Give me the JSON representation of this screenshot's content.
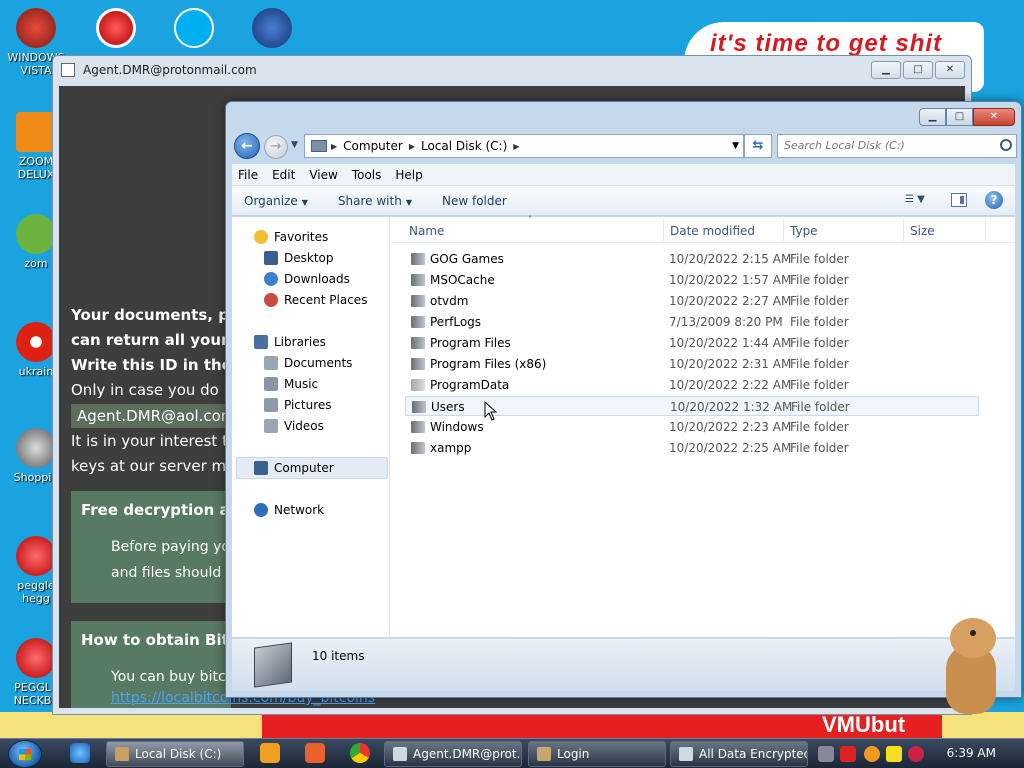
{
  "desktop": {
    "banner_text": "it's time to get shit",
    "bottom_text": "VMUbut",
    "icons": [
      {
        "label": "WINDOWS VISTA"
      },
      {
        "label": "ZOOM DELUX"
      },
      {
        "label": "zom"
      },
      {
        "label": "ukrain"
      },
      {
        "label": "Shoppin"
      },
      {
        "label": "peggle hegg"
      },
      {
        "label": "PEGGLE NECKBE"
      }
    ]
  },
  "ransom_window": {
    "title": "Agent.DMR@protonmail.com",
    "line1": "Your documents, pho",
    "line2": "can return all your fi",
    "line3": "Write this ID in the s",
    "line4": "Only in case you do not",
    "email": "Agent.DMR@aol.com",
    "line5": "It is in your interest to r",
    "line6": "keys at our server more",
    "box1_heading": "Free decryption as",
    "box1_line1": "Before paying you",
    "box1_line2": "and files should no",
    "box2_heading": "How to obtain Bitco",
    "box2_line1": "You can buy bitco",
    "link": "https://localbitcoins.com/buy_bitcoins"
  },
  "explorer": {
    "address": {
      "seg1": "Computer",
      "seg2": "Local Disk (C:)"
    },
    "search_placeholder": "Search Local Disk (C:)",
    "menu": [
      "File",
      "Edit",
      "View",
      "Tools",
      "Help"
    ],
    "toolbar": {
      "organize": "Organize",
      "share_with": "Share with",
      "new_folder": "New folder"
    },
    "nav": {
      "favorites": "Favorites",
      "desktop": "Desktop",
      "downloads": "Downloads",
      "recent_places": "Recent Places",
      "libraries": "Libraries",
      "documents": "Documents",
      "music": "Music",
      "pictures": "Pictures",
      "videos": "Videos",
      "computer": "Computer",
      "network": "Network"
    },
    "columns": {
      "name": "Name",
      "date": "Date modified",
      "type": "Type",
      "size": "Size"
    },
    "files": [
      {
        "name": "GOG Games",
        "date": "10/20/2022 2:15 AM",
        "type": "File folder"
      },
      {
        "name": "MSOCache",
        "date": "10/20/2022 1:57 AM",
        "type": "File folder"
      },
      {
        "name": "otvdm",
        "date": "10/20/2022 2:27 AM",
        "type": "File folder"
      },
      {
        "name": "PerfLogs",
        "date": "7/13/2009 8:20 PM",
        "type": "File folder"
      },
      {
        "name": "Program Files",
        "date": "10/20/2022 1:44 AM",
        "type": "File folder"
      },
      {
        "name": "Program Files (x86)",
        "date": "10/20/2022 2:31 AM",
        "type": "File folder"
      },
      {
        "name": "ProgramData",
        "date": "10/20/2022 2:22 AM",
        "type": "File folder"
      },
      {
        "name": "Users",
        "date": "10/20/2022 1:32 AM",
        "type": "File folder"
      },
      {
        "name": "Windows",
        "date": "10/20/2022 2:23 AM",
        "type": "File folder"
      },
      {
        "name": "xampp",
        "date": "10/20/2022 2:25 AM",
        "type": "File folder"
      }
    ],
    "status_count": "10 items"
  },
  "taskbar": {
    "local_disk": "Local Disk (C:)",
    "agent": "Agent.DMR@prot...",
    "login": "Login",
    "all_data": "All Data Encrypted",
    "clock": "6:39 AM"
  }
}
